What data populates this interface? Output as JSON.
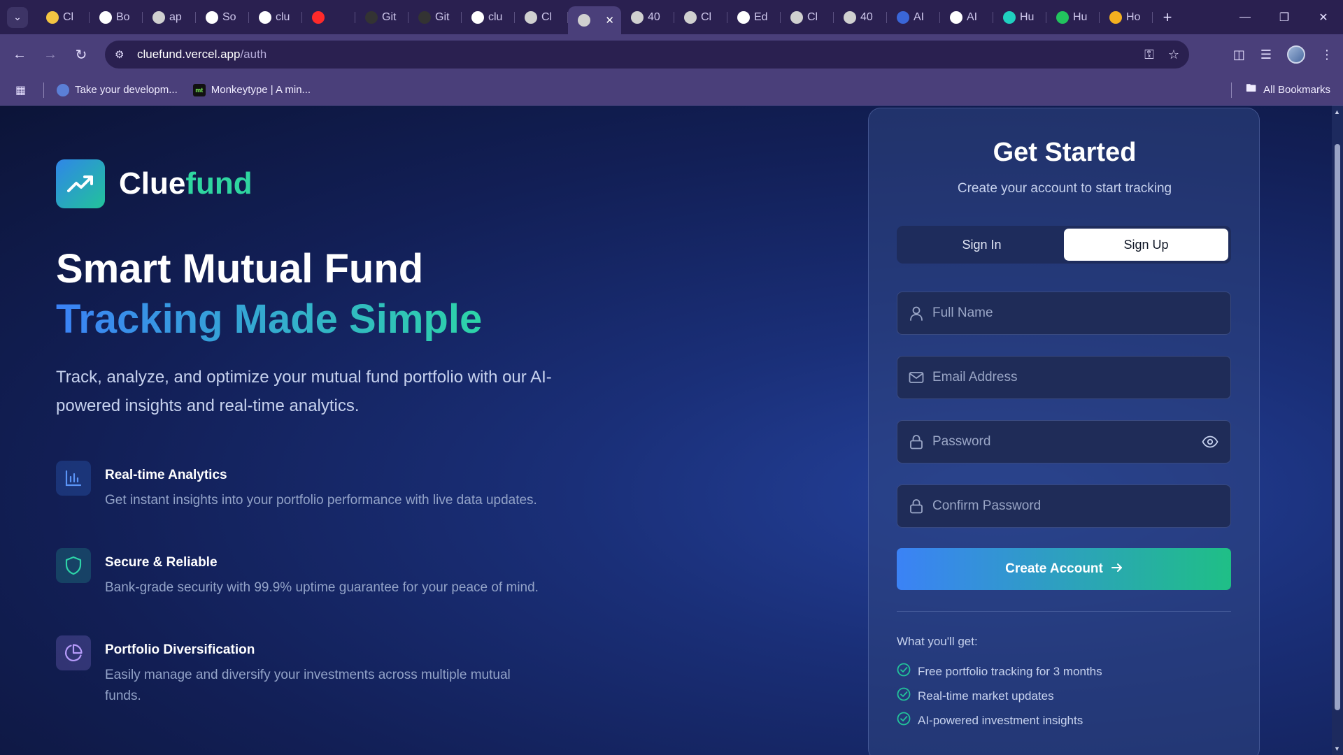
{
  "browser": {
    "tabs": [
      {
        "label": "Cl",
        "favicon_color": "#f4c542"
      },
      {
        "label": "Bo",
        "favicon_color": "#ffffff"
      },
      {
        "label": "ap",
        "favicon_color": "#d0d0d0"
      },
      {
        "label": "So",
        "favicon_color": "#ffffff"
      },
      {
        "label": "clu",
        "favicon_color": "#ffffff"
      },
      {
        "label": "",
        "favicon_color": "#ff2a2a"
      },
      {
        "label": "Git",
        "favicon_color": "#333333"
      },
      {
        "label": "Git",
        "favicon_color": "#333333"
      },
      {
        "label": "clu",
        "favicon_color": "#ffffff"
      },
      {
        "label": "Cl",
        "favicon_color": "#d0d0d0"
      },
      {
        "label": "",
        "favicon_color": "#d0d0d0",
        "active": true
      },
      {
        "label": "40",
        "favicon_color": "#d0d0d0"
      },
      {
        "label": "Cl",
        "favicon_color": "#d0d0d0"
      },
      {
        "label": "Ed",
        "favicon_color": "#ffffff"
      },
      {
        "label": "Cl",
        "favicon_color": "#d0d0d0"
      },
      {
        "label": "40",
        "favicon_color": "#d0d0d0"
      },
      {
        "label": "AI",
        "favicon_color": "#3a66d8"
      },
      {
        "label": "AI",
        "favicon_color": "#ffffff"
      },
      {
        "label": "Hu",
        "favicon_color": "#20d0c0"
      },
      {
        "label": "Hu",
        "favicon_color": "#22c35e"
      },
      {
        "label": "Ho",
        "favicon_color": "#f5b020"
      }
    ],
    "url_host": "cluefund.vercel.app",
    "url_path": "/auth",
    "bookmarks": [
      {
        "label": "Take your developm...",
        "icon_color": "#5b7fd6"
      },
      {
        "label": "Monkeytype | A min...",
        "icon_color": "#111111",
        "icon_text": "mt"
      }
    ],
    "all_bookmarks_label": "All Bookmarks"
  },
  "brand": {
    "name_main": "Clue",
    "name_accent": "fund"
  },
  "hero": {
    "line1": "Smart Mutual Fund",
    "line2": "Tracking Made Simple",
    "lead": "Track, analyze, and optimize your mutual fund portfolio with our AI-powered insights and real-time analytics."
  },
  "features": [
    {
      "title": "Real-time Analytics",
      "desc": "Get instant insights into your portfolio performance with live data updates.",
      "icon": "bar-chart-icon",
      "color": "#3b82f6"
    },
    {
      "title": "Secure & Reliable",
      "desc": "Bank-grade security with 99.9% uptime guarantee for your peace of mind.",
      "icon": "shield-icon",
      "color": "#2dd4a8"
    },
    {
      "title": "Portfolio Diversification",
      "desc": "Easily manage and diversify your investments across multiple mutual funds.",
      "icon": "pie-chart-icon",
      "color": "#a78bfa"
    }
  ],
  "auth": {
    "title": "Get Started",
    "subtitle": "Create your account to start tracking",
    "tab_sign_in": "Sign In",
    "tab_sign_up": "Sign Up",
    "active_tab": "Sign Up",
    "fields": {
      "full_name": {
        "placeholder": "Full Name",
        "value": ""
      },
      "email": {
        "placeholder": "Email Address",
        "value": ""
      },
      "password": {
        "placeholder": "Password",
        "value": ""
      },
      "confirm_password": {
        "placeholder": "Confirm Password",
        "value": ""
      }
    },
    "cta_label": "Create Account",
    "perks_title": "What you'll get:",
    "perks": [
      "Free portfolio tracking for 3 months",
      "Real-time market updates",
      "AI-powered investment insights"
    ]
  },
  "colors": {
    "accent_green": "#2fd6a0",
    "accent_blue": "#3b82f6"
  }
}
